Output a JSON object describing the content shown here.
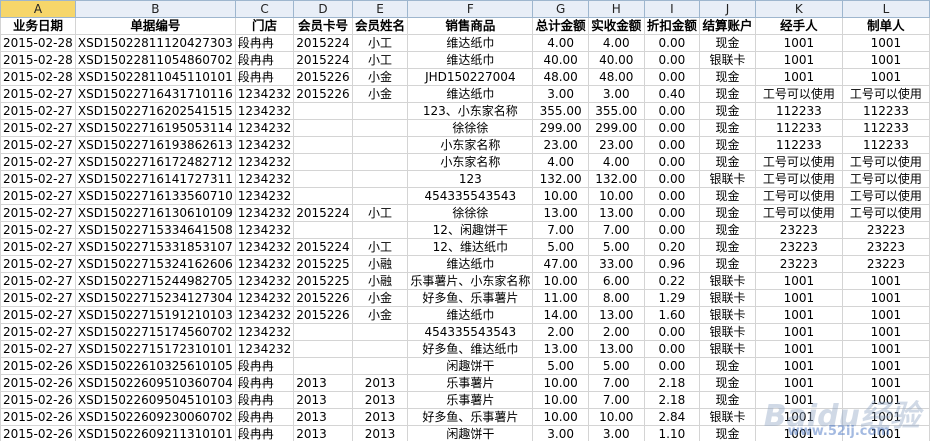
{
  "columns": [
    "A",
    "B",
    "C",
    "D",
    "E",
    "F",
    "G",
    "H",
    "I",
    "J",
    "K",
    "L"
  ],
  "headers": [
    "业务日期",
    "单据编号",
    "门店",
    "会员卡号",
    "会员姓名",
    "销售商品",
    "总计金额",
    "实收金额",
    "折扣金额",
    "结算账户",
    "经手人",
    "制单人"
  ],
  "rows": [
    [
      "2015-02-28",
      "XSD15022811120427303",
      "段冉冉",
      "2015224",
      "小工",
      "维达纸巾",
      "4.00",
      "4.00",
      "0.00",
      "现金",
      "1001",
      "1001"
    ],
    [
      "2015-02-28",
      "XSD15022811054860702",
      "段冉冉",
      "2015224",
      "小工",
      "维达纸巾",
      "40.00",
      "40.00",
      "0.00",
      "银联卡",
      "1001",
      "1001"
    ],
    [
      "2015-02-28",
      "XSD15022811045110101",
      "段冉冉",
      "2015226",
      "小金",
      "JHD150227004",
      "48.00",
      "48.00",
      "0.00",
      "现金",
      "1001",
      "1001"
    ],
    [
      "2015-02-27",
      "XSD15022716431710116",
      "1234232",
      "2015226",
      "小金",
      "维达纸巾",
      "3.00",
      "3.00",
      "0.40",
      "现金",
      "工号可以使用",
      "工号可以使用"
    ],
    [
      "2015-02-27",
      "XSD15022716202541515",
      "1234232",
      "",
      "",
      "123、小东家名称",
      "355.00",
      "355.00",
      "0.00",
      "现金",
      "112233",
      "112233"
    ],
    [
      "2015-02-27",
      "XSD15022716195053114",
      "1234232",
      "",
      "",
      "徐徐徐",
      "299.00",
      "299.00",
      "0.00",
      "现金",
      "112233",
      "112233"
    ],
    [
      "2015-02-27",
      "XSD15022716193862613",
      "1234232",
      "",
      "",
      "小东家名称",
      "23.00",
      "23.00",
      "0.00",
      "现金",
      "112233",
      "112233"
    ],
    [
      "2015-02-27",
      "XSD15022716172482712",
      "1234232",
      "",
      "",
      "小东家名称",
      "4.00",
      "4.00",
      "0.00",
      "现金",
      "工号可以使用",
      "工号可以使用"
    ],
    [
      "2015-02-27",
      "XSD15022716141727311",
      "1234232",
      "",
      "",
      "123",
      "132.00",
      "132.00",
      "0.00",
      "银联卡",
      "工号可以使用",
      "工号可以使用"
    ],
    [
      "2015-02-27",
      "XSD15022716133560710",
      "1234232",
      "",
      "",
      "454335543543",
      "10.00",
      "10.00",
      "0.00",
      "现金",
      "工号可以使用",
      "工号可以使用"
    ],
    [
      "2015-02-27",
      "XSD15022716130610109",
      "1234232",
      "2015224",
      "小工",
      "徐徐徐",
      "13.00",
      "13.00",
      "0.00",
      "现金",
      "工号可以使用",
      "工号可以使用"
    ],
    [
      "2015-02-27",
      "XSD15022715334641508",
      "1234232",
      "",
      "",
      "12、闲趣饼干",
      "7.00",
      "7.00",
      "0.00",
      "现金",
      "23223",
      "23223"
    ],
    [
      "2015-02-27",
      "XSD15022715331853107",
      "1234232",
      "2015224",
      "小工",
      "12、维达纸巾",
      "5.00",
      "5.00",
      "0.20",
      "现金",
      "23223",
      "23223"
    ],
    [
      "2015-02-27",
      "XSD15022715324162606",
      "1234232",
      "2015225",
      "小融",
      "维达纸巾",
      "47.00",
      "33.00",
      "0.96",
      "现金",
      "23223",
      "23223"
    ],
    [
      "2015-02-27",
      "XSD15022715244982705",
      "1234232",
      "2015225",
      "小融",
      "乐事薯片、小东家名称",
      "10.00",
      "6.00",
      "0.22",
      "银联卡",
      "1001",
      "1001"
    ],
    [
      "2015-02-27",
      "XSD15022715234127304",
      "1234232",
      "2015226",
      "小金",
      "好多鱼、乐事薯片",
      "11.00",
      "8.00",
      "1.29",
      "银联卡",
      "1001",
      "1001"
    ],
    [
      "2015-02-27",
      "XSD15022715191210103",
      "1234232",
      "2015226",
      "小金",
      "维达纸巾",
      "14.00",
      "13.00",
      "1.60",
      "银联卡",
      "1001",
      "1001"
    ],
    [
      "2015-02-27",
      "XSD15022715174560702",
      "1234232",
      "",
      "",
      "454335543543",
      "2.00",
      "2.00",
      "0.00",
      "银联卡",
      "1001",
      "1001"
    ],
    [
      "2015-02-27",
      "XSD15022715172310101",
      "1234232",
      "",
      "",
      "好多鱼、维达纸巾",
      "13.00",
      "13.00",
      "0.00",
      "银联卡",
      "1001",
      "1001"
    ],
    [
      "2015-02-26",
      "XSD15022610325610105",
      "段冉冉",
      "",
      "",
      "闲趣饼干",
      "5.00",
      "5.00",
      "0.00",
      "现金",
      "1001",
      "1001"
    ],
    [
      "2015-02-26",
      "XSD15022609510360704",
      "段冉冉",
      "2013",
      "2013",
      "乐事薯片",
      "10.00",
      "7.00",
      "2.18",
      "现金",
      "1001",
      "1001"
    ],
    [
      "2015-02-26",
      "XSD15022609504510103",
      "段冉冉",
      "2013",
      "2013",
      "乐事薯片",
      "10.00",
      "7.00",
      "2.18",
      "现金",
      "1001",
      "1001"
    ],
    [
      "2015-02-26",
      "XSD15022609230060702",
      "段冉冉",
      "2013",
      "2013",
      "好多鱼、乐事薯片",
      "10.00",
      "10.00",
      "2.84",
      "银联卡",
      "1001",
      "1001"
    ],
    [
      "2015-02-26",
      "XSD15022609211310101",
      "段冉冉",
      "2013",
      "2013",
      "闲趣饼干",
      "3.00",
      "3.00",
      "1.10",
      "现金",
      "1001",
      "1001"
    ]
  ],
  "watermark": {
    "text": "Baidu经验",
    "subtext": "www.52ij.com"
  }
}
